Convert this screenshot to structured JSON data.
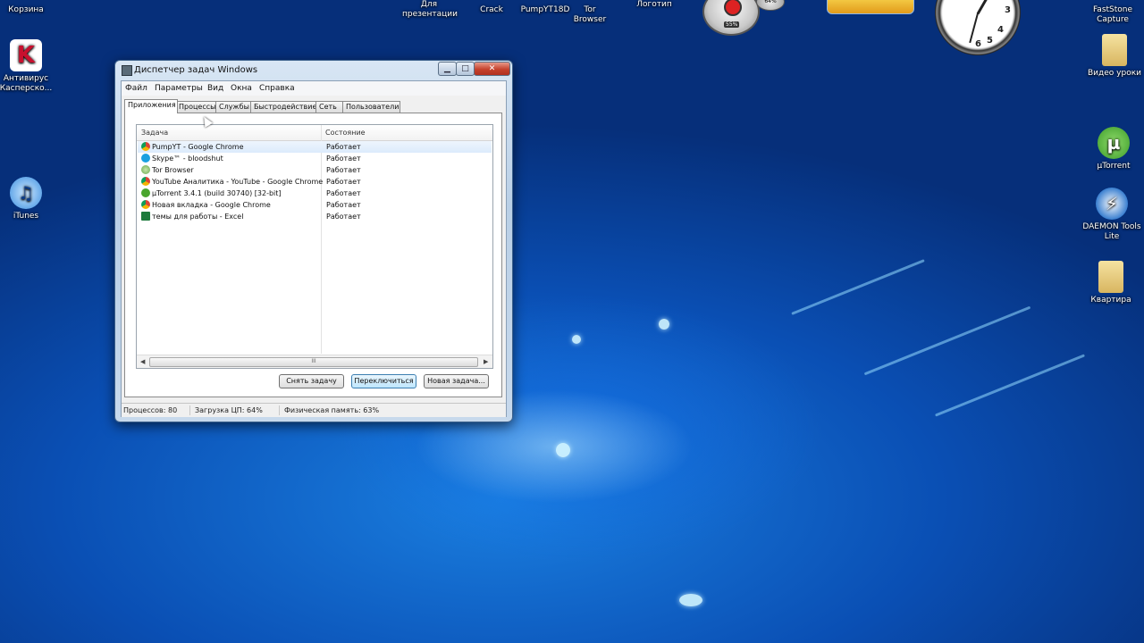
{
  "desktop": {
    "top_labels": [
      {
        "id": "korzina",
        "text": "Корзина"
      },
      {
        "id": "presentation",
        "text": "Для презентации"
      },
      {
        "id": "crack",
        "text": "Crack"
      },
      {
        "id": "pumpyt",
        "text": "PumpYT18D"
      },
      {
        "id": "tor",
        "text": "Tor Browser"
      },
      {
        "id": "logo",
        "text": "Логотип"
      },
      {
        "id": "faststone",
        "text": "FastStone Capture"
      }
    ],
    "left_icons": [
      {
        "label": "Антивирус Касперско...",
        "icon": "kaspersky-icon"
      },
      {
        "label": "iTunes",
        "icon": "itunes-icon"
      }
    ],
    "right_icons": [
      {
        "label": "Видео уроки",
        "icon": "folder-icon"
      },
      {
        "label": "µTorrent",
        "icon": "utorrent-icon"
      },
      {
        "label": "DAEMON Tools Lite",
        "icon": "daemon-tools-icon"
      },
      {
        "label": "Квартира",
        "icon": "folder-icon"
      }
    ],
    "gadget_meter": {
      "cpu_pct": "55%",
      "mem_pct": "64%"
    },
    "clock_numbers": [
      "3",
      "4",
      "5",
      "6"
    ]
  },
  "window": {
    "title": "Диспетчер задач Windows",
    "controls": {
      "minimize": "▁",
      "maximize": "□",
      "close": "✕"
    },
    "menu": [
      "Файл",
      "Параметры",
      "Вид",
      "Окна",
      "Справка"
    ],
    "tabs": [
      "Приложения",
      "Процессы",
      "Службы",
      "Быстродействие",
      "Сеть",
      "Пользователи"
    ],
    "active_tab": "Приложения",
    "columns": {
      "task": "Задача",
      "status": "Состояние"
    },
    "tasks": [
      {
        "name": "PumpYT - Google Chrome",
        "status": "Работает",
        "icon": "chrome-icon",
        "color": "#e0a020"
      },
      {
        "name": "Skype™ - bloodshut",
        "status": "Работает",
        "icon": "skype-icon",
        "color": "#1aa0e0"
      },
      {
        "name": "Tor Browser",
        "status": "Работает",
        "icon": "tor-icon",
        "color": "#6aa84f"
      },
      {
        "name": "YouTube Аналитика - YouTube - Google Chrome",
        "status": "Работает",
        "icon": "chrome-icon",
        "color": "#e0a020"
      },
      {
        "name": "µTorrent 3.4.1  (build 30740) [32-bit]",
        "status": "Работает",
        "icon": "utorrent-icon",
        "color": "#4aa52e"
      },
      {
        "name": "Новая вкладка - Google Chrome",
        "status": "Работает",
        "icon": "chrome-icon",
        "color": "#e0a020"
      },
      {
        "name": "темы для работы - Excel",
        "status": "Работает",
        "icon": "excel-icon",
        "color": "#1d7a3c"
      }
    ],
    "scroll_thumb_text": "III",
    "buttons": {
      "end_task": "Снять задачу",
      "switch_to": "Переключиться",
      "new_task": "Новая задача..."
    },
    "status": {
      "processes": "Процессов: 80",
      "cpu": "Загрузка ЦП: 64%",
      "memory": "Физическая память: 63%"
    }
  }
}
